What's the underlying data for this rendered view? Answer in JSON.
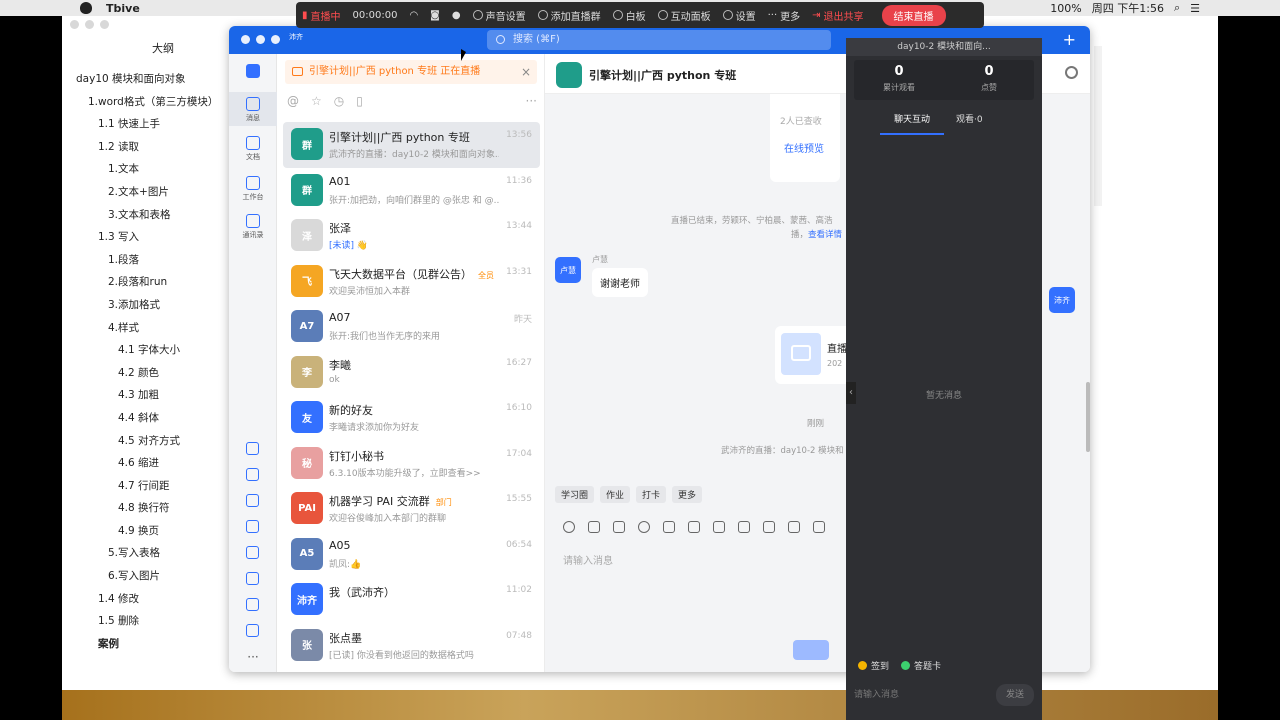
{
  "menubar": {
    "app_name": "Tbive",
    "battery": "100%",
    "clock": "周四 下午1:56"
  },
  "outline": {
    "title": "大纲",
    "items": [
      {
        "text": "day10 模块和面向对象",
        "level": 0
      },
      {
        "text": "1.word格式（第三方模块）",
        "level": 1
      },
      {
        "text": "1.1 快速上手",
        "level": 2
      },
      {
        "text": "1.2 读取",
        "level": 2
      },
      {
        "text": "1.文本",
        "level": 3
      },
      {
        "text": "2.文本+图片",
        "level": 3
      },
      {
        "text": "3.文本和表格",
        "level": 3
      },
      {
        "text": "1.3 写入",
        "level": 2
      },
      {
        "text": "1.段落",
        "level": 3
      },
      {
        "text": "2.段落和run",
        "level": 3
      },
      {
        "text": "3.添加格式",
        "level": 3
      },
      {
        "text": "4.样式",
        "level": 3
      },
      {
        "text": "4.1 字体大小",
        "level": 4
      },
      {
        "text": "4.2 颜色",
        "level": 4
      },
      {
        "text": "4.3 加粗",
        "level": 4
      },
      {
        "text": "4.4 斜体",
        "level": 4
      },
      {
        "text": "4.5 对齐方式",
        "level": 4
      },
      {
        "text": "4.6 缩进",
        "level": 4
      },
      {
        "text": "4.7 行间距",
        "level": 4
      },
      {
        "text": "4.8 换行符",
        "level": 4
      },
      {
        "text": "4.9 换页",
        "level": 4
      },
      {
        "text": "5.写入表格",
        "level": 3
      },
      {
        "text": "6.写入图片",
        "level": 3
      },
      {
        "text": "1.4 修改",
        "level": 2
      },
      {
        "text": "1.5 删除",
        "level": 2
      },
      {
        "text": "案例",
        "level": 2,
        "bold": true
      }
    ]
  },
  "livebar": {
    "status": "直播中",
    "timer": "00:00:00",
    "mic": "声音设置",
    "add_group": "添加直播群",
    "whiteboard": "白板",
    "interact": "互动面板",
    "settings": "设置",
    "more": "更多",
    "stop_share": "退出共享",
    "end_live": "结束直播"
  },
  "ding": {
    "avatar_text": "沛齐",
    "search_placeholder": "搜索 (⌘F)",
    "rail": [
      {
        "label": "消息",
        "name": "rail-messages"
      },
      {
        "label": "文档",
        "name": "rail-docs"
      },
      {
        "label": "工作台",
        "name": "rail-workbench"
      },
      {
        "label": "通讯录",
        "name": "rail-contacts"
      }
    ],
    "live_banner": "引擎计划||广西 python 专班 正在直播",
    "conversations": [
      {
        "name": "引擎计划||广西 python 专班",
        "msg": "武沛齐的直播：day10-2 模块和面向对象...",
        "time": "13:56",
        "color": "#1f9d8a",
        "avatar": "群",
        "selected": true
      },
      {
        "name": "A01",
        "msg": "张开:加把劲，向咱们群里的 @张忠 和 @...",
        "time": "11:36",
        "color": "#1f9d8a",
        "avatar": "群"
      },
      {
        "name": "张泽",
        "msg": "[未读] 👋",
        "time": "13:44",
        "color": "#d9d9d9",
        "avatar": "泽",
        "unread": true
      },
      {
        "name": "飞天大数据平台（见群公告）",
        "msg": "欢迎吴沛恒加入本群",
        "time": "13:31",
        "color": "#f5a623",
        "avatar": "飞",
        "tag": "全员"
      },
      {
        "name": "A07",
        "msg": "张开:我们也当作无序的来用",
        "time": "昨天",
        "color": "#5b7db8",
        "avatar": "A7"
      },
      {
        "name": "李曦",
        "msg": "ok",
        "time": "16:27",
        "color": "#c9b27a",
        "avatar": "李"
      },
      {
        "name": "新的好友",
        "msg": "李曦请求添加你为好友",
        "time": "16:10",
        "color": "#3370ff",
        "avatar": "友"
      },
      {
        "name": "钉钉小秘书",
        "msg": "6.3.10版本功能升级了，立即查看>>",
        "time": "17:04",
        "color": "#e8a0a0",
        "avatar": "秘"
      },
      {
        "name": "机器学习 PAI 交流群",
        "msg": "欢迎谷俊峰加入本部门的群聊",
        "time": "15:55",
        "color": "#e8553c",
        "avatar": "PAI",
        "tag": "部门"
      },
      {
        "name": "A05",
        "msg": "凯凤:👍",
        "time": "06:54",
        "color": "#5b7db8",
        "avatar": "A5"
      },
      {
        "name": "我（武沛齐）",
        "msg": "",
        "time": "11:02",
        "color": "#3370ff",
        "avatar": "沛齐"
      },
      {
        "name": "张点墨",
        "msg": "[已读] 你没看到他返回的数据格式吗",
        "time": "07:48",
        "color": "#7b8aa8",
        "avatar": "张"
      }
    ],
    "chat": {
      "title": "引擎计划||广西 python 专班",
      "read_count": "2人已查收",
      "preview_link": "在线预览",
      "sys_ended": "直播已结束，劳颖环、宁柏晨、蒙茜、高浩",
      "sys_ended_2": "播，",
      "sys_ended_link": "查看详情",
      "sender_name": "卢慧",
      "sender_avatar": "卢慧",
      "message": "谢谢老师",
      "live_card_title": "直播",
      "live_card_sub": "202",
      "just_now": "刚刚",
      "sys_live": "武沛齐的直播：day10-2 模块和",
      "quick_tags": [
        "学习圈",
        "作业",
        "打卡",
        "更多"
      ],
      "input_placeholder": "请输入消息",
      "side_avatar": "沛齐"
    }
  },
  "panel": {
    "title": "day10-2 模块和面向...",
    "viewers": "0",
    "viewers_label": "累计观看",
    "likes": "0",
    "likes_label": "点赞",
    "tab_chat": "聊天互动",
    "tab_watch": "观看·0",
    "empty": "暂无消息",
    "checkin": "签到",
    "quiz": "答题卡",
    "input_placeholder": "请输入消息",
    "send": "发送"
  }
}
